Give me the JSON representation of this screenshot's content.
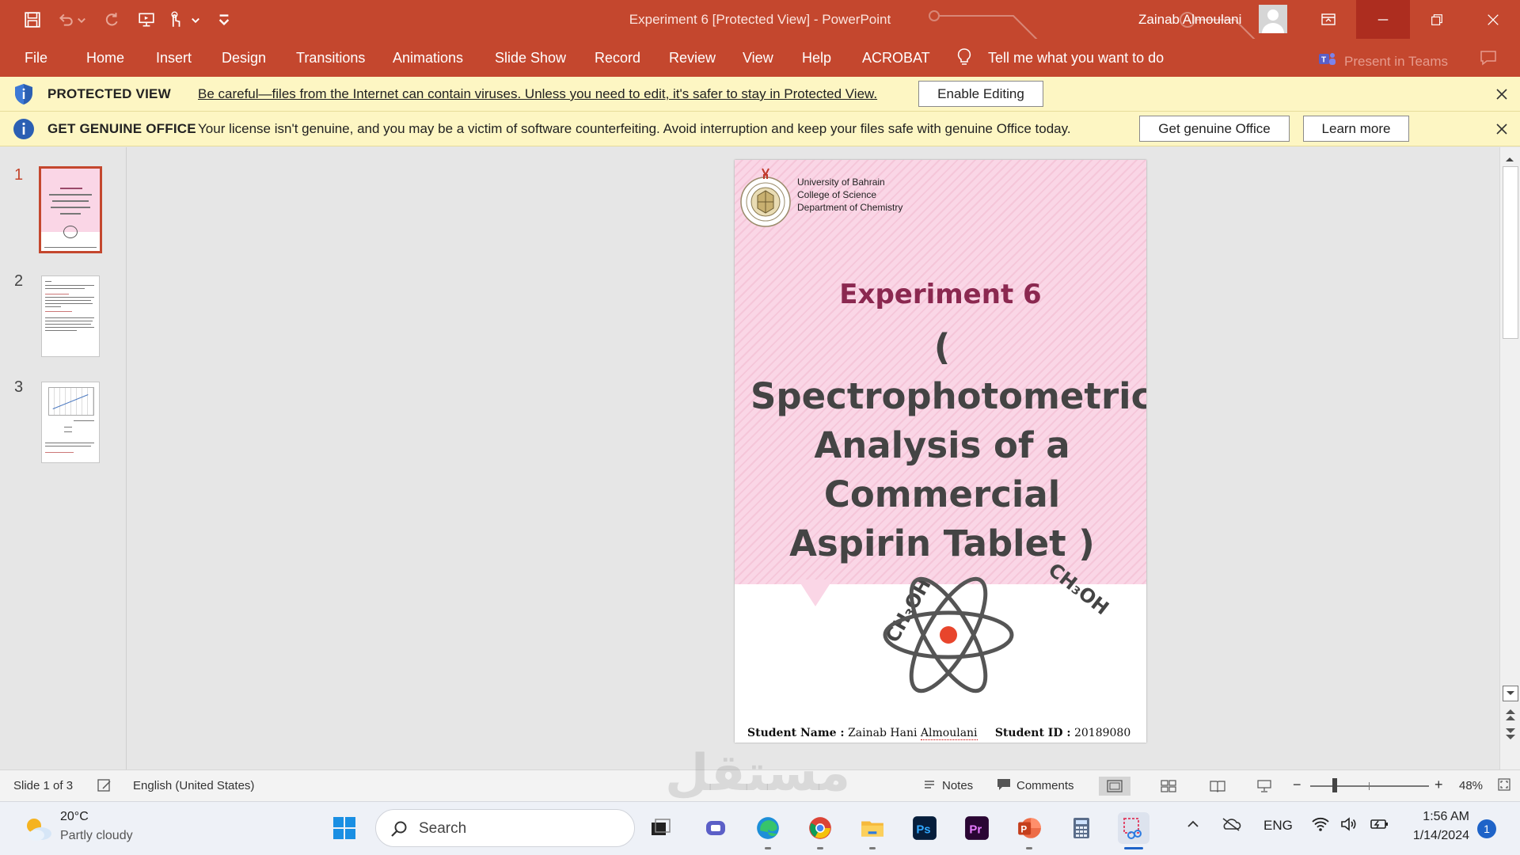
{
  "window": {
    "title": "Experiment 6 [Protected View]  -  PowerPoint",
    "user": "Zainab Almoulani"
  },
  "ribbon": {
    "tabs": [
      "File",
      "Home",
      "Insert",
      "Design",
      "Transitions",
      "Animations",
      "Slide Show",
      "Record",
      "Review",
      "View",
      "Help",
      "ACROBAT"
    ],
    "tell_me": "Tell me what you want to do",
    "present_in_teams": "Present in Teams"
  },
  "protected_bar": {
    "title": "PROTECTED VIEW",
    "message": "Be careful—files from the Internet can contain viruses. Unless you need to edit, it's safer to stay in Protected View.",
    "button": "Enable Editing"
  },
  "genuine_bar": {
    "title": "GET GENUINE OFFICE",
    "message": "Your license isn't genuine, and you may be a victim of software counterfeiting. Avoid interruption and keep your files safe with genuine Office today.",
    "button_primary": "Get genuine Office",
    "button_secondary": "Learn more"
  },
  "thumbnails": {
    "numbers": [
      "1",
      "2",
      "3"
    ],
    "selected": 1
  },
  "slide": {
    "university_lines": [
      "University of Bahrain",
      "College of Science",
      "Department of Chemistry"
    ],
    "heading": "Experiment 6",
    "title": "( Spectrophotometric Analysis of a Commercial Aspirin Tablet )",
    "chem_left": "CH₃OH",
    "chem_right": "CH₃OH",
    "student_name_label": "Student Name :",
    "student_name_value": "Zainab Hani",
    "student_name_surname": "Almoulani",
    "student_id_label": "Student ID :",
    "student_id_value": "20189080"
  },
  "statusbar": {
    "slide_info": "Slide 1 of 3",
    "language": "English (United States)",
    "notes": "Notes",
    "comments": "Comments",
    "zoom": "48%"
  },
  "taskbar": {
    "weather_temp": "20°C",
    "weather_desc": "Partly cloudy",
    "search_placeholder": "Search",
    "lang": "ENG",
    "time": "1:56 AM",
    "date": "1/14/2024",
    "notifications": "1"
  },
  "watermark": "مستقل",
  "colors": {
    "accent": "#c4472e",
    "message_bar": "#fdf6c3",
    "slide_pink": "#fad6e6",
    "heading_color": "#8b2850"
  }
}
